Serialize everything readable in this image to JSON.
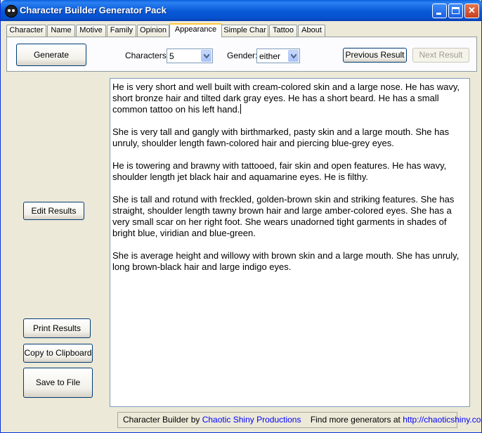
{
  "window": {
    "title": "Character Builder Generator Pack"
  },
  "tabs": [
    {
      "label": "Character"
    },
    {
      "label": "Name"
    },
    {
      "label": "Motive"
    },
    {
      "label": "Family"
    },
    {
      "label": "Opinion"
    },
    {
      "label": "Appearance",
      "active": true
    },
    {
      "label": "Simple Char"
    },
    {
      "label": "Tattoo"
    },
    {
      "label": "About"
    }
  ],
  "controls": {
    "generate_label": "Generate",
    "characters_label": "Characters:",
    "characters_value": "5",
    "gender_label": "Gender:",
    "gender_value": "either",
    "previous_label": "Previous Result",
    "next_label": "Next Result"
  },
  "sidebar": {
    "edit_label": "Edit Results",
    "print_label": "Print Results",
    "copy_label": "Copy to Clipboard",
    "save_label": "Save to File"
  },
  "results": [
    "He is very short and well built with cream-colored skin and a large nose. He has wavy, short bronze hair and tilted dark gray eyes. He has a short beard. He has a small common tattoo on his left hand.",
    "She is very tall and gangly with birthmarked, pasty skin and a large mouth. She has unruly, shoulder length fawn-colored hair and piercing blue-grey eyes.",
    "He is towering and brawny with tattooed, fair skin and open features. He has wavy, shoulder length jet black hair and aquamarine eyes. He is filthy.",
    "She is tall and rotund with freckled, golden-brown skin and striking features. She has straight, shoulder length tawny brown hair and large amber-colored eyes. She has a very small scar on her right foot. She wears unadorned tight garments in shades of bright blue, viridian and blue-green.",
    "She is average height and willowy with brown skin and a large mouth. She has unruly, long brown-black hair and large indigo eyes."
  ],
  "status": {
    "prefix": "Character Builder by ",
    "company": "Chaotic Shiny Productions",
    "middle": "Find more generators at ",
    "url": "http://chaoticshiny.com/"
  },
  "icons": {
    "app": "skull-icon",
    "minimize": "minimize-icon",
    "maximize": "maximize-icon",
    "close": "close-icon",
    "dropdown": "chevron-down-icon"
  },
  "colors": {
    "titlebar": "#0858d6",
    "window_bg": "#ece9d8",
    "active_tab_accent": "#ffc83c",
    "link": "#0000ff"
  }
}
